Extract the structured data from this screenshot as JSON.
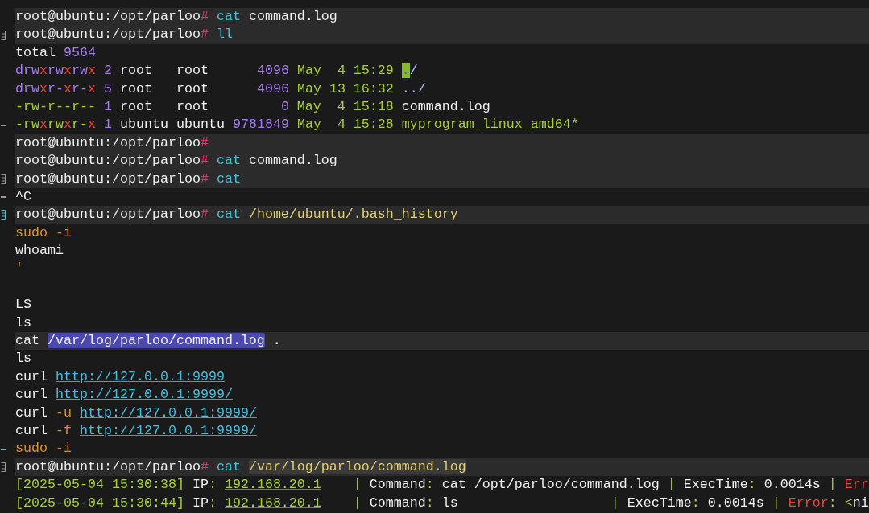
{
  "terminal": {
    "lines": [
      {
        "highlighted": true,
        "segments": [
          {
            "kind": "plain",
            "text": "root@ubuntu:/opt/parloo"
          },
          {
            "kind": "hash",
            "text": "# "
          },
          {
            "kind": "cmd",
            "text": "cat"
          },
          {
            "kind": "plain",
            "text": " command.log"
          }
        ]
      },
      {
        "highlighted": true,
        "gutter": {
          "kind": "box"
        },
        "segments": [
          {
            "kind": "plain",
            "text": "root@ubuntu:/opt/parloo"
          },
          {
            "kind": "hash",
            "text": "# "
          },
          {
            "kind": "cmd",
            "text": "ll"
          }
        ]
      },
      {
        "highlighted": false,
        "segments": [
          {
            "kind": "plain",
            "text": "total "
          },
          {
            "kind": "num",
            "text": "9564"
          }
        ]
      },
      {
        "highlighted": false,
        "segments": [
          {
            "kind": "num",
            "text": "drw"
          },
          {
            "kind": "err",
            "text": "x"
          },
          {
            "kind": "num",
            "text": "rw"
          },
          {
            "kind": "err",
            "text": "x"
          },
          {
            "kind": "num",
            "text": "rw"
          },
          {
            "kind": "err",
            "text": "x"
          },
          {
            "kind": "num",
            "text": " 2"
          },
          {
            "kind": "plain",
            "text": " root   root      "
          },
          {
            "kind": "num",
            "text": "4096"
          },
          {
            "kind": "green",
            "text": " May  4 15:29 "
          },
          {
            "kind": "cursor",
            "text": "."
          },
          {
            "kind": "dir",
            "text": "/"
          }
        ]
      },
      {
        "highlighted": false,
        "segments": [
          {
            "kind": "num",
            "text": "drw"
          },
          {
            "kind": "err",
            "text": "x"
          },
          {
            "kind": "num",
            "text": "r-"
          },
          {
            "kind": "err",
            "text": "x"
          },
          {
            "kind": "num",
            "text": "r-"
          },
          {
            "kind": "err",
            "text": "x"
          },
          {
            "kind": "num",
            "text": " 5"
          },
          {
            "kind": "plain",
            "text": " root   root      "
          },
          {
            "kind": "num",
            "text": "4096"
          },
          {
            "kind": "green",
            "text": " May 13 16:32"
          },
          {
            "kind": "dir",
            "text": " ../"
          }
        ]
      },
      {
        "highlighted": false,
        "segments": [
          {
            "kind": "green",
            "text": "-rw-r--r--"
          },
          {
            "kind": "num",
            "text": " 1"
          },
          {
            "kind": "plain",
            "text": " root   root         "
          },
          {
            "kind": "num",
            "text": "0"
          },
          {
            "kind": "green",
            "text": " May  4 15:18"
          },
          {
            "kind": "plain",
            "text": " command.log"
          }
        ]
      },
      {
        "highlighted": false,
        "gutter": {
          "kind": "dash"
        },
        "segments": [
          {
            "kind": "green",
            "text": "-rw"
          },
          {
            "kind": "err",
            "text": "x"
          },
          {
            "kind": "green",
            "text": "rw"
          },
          {
            "kind": "err",
            "text": "x"
          },
          {
            "kind": "green",
            "text": "r-"
          },
          {
            "kind": "err",
            "text": "x"
          },
          {
            "kind": "num",
            "text": " 1"
          },
          {
            "kind": "plain",
            "text": " ubuntu ubuntu "
          },
          {
            "kind": "num",
            "text": "9781849"
          },
          {
            "kind": "green",
            "text": " May  4 15:28 myprogram_linux_amd64*"
          }
        ]
      },
      {
        "highlighted": true,
        "segments": [
          {
            "kind": "plain",
            "text": "root@ubuntu:/opt/parloo"
          },
          {
            "kind": "hash",
            "text": "#"
          }
        ]
      },
      {
        "highlighted": true,
        "segments": [
          {
            "kind": "plain",
            "text": "root@ubuntu:/opt/parloo"
          },
          {
            "kind": "hash",
            "text": "# "
          },
          {
            "kind": "cmd",
            "text": "cat"
          },
          {
            "kind": "plain",
            "text": " command.log"
          }
        ]
      },
      {
        "highlighted": true,
        "gutter": {
          "kind": "box"
        },
        "segments": [
          {
            "kind": "plain",
            "text": "root@ubuntu:/opt/parloo"
          },
          {
            "kind": "hash",
            "text": "# "
          },
          {
            "kind": "cmd",
            "text": "cat"
          }
        ]
      },
      {
        "highlighted": false,
        "gutter": {
          "kind": "dash"
        },
        "segments": [
          {
            "kind": "plain",
            "text": "^C"
          }
        ]
      },
      {
        "highlighted": true,
        "gutter": {
          "kind": "box-active"
        },
        "segments": [
          {
            "kind": "plain",
            "text": "root@ubuntu:/opt/parloo"
          },
          {
            "kind": "hash",
            "text": "# "
          },
          {
            "kind": "cmd",
            "text": "cat "
          },
          {
            "kind": "arg",
            "text": "/home/ubuntu/.bash_history"
          }
        ]
      },
      {
        "highlighted": false,
        "segments": [
          {
            "kind": "flag",
            "text": "sudo -i"
          }
        ]
      },
      {
        "highlighted": false,
        "segments": [
          {
            "kind": "plain",
            "text": "whoami"
          }
        ]
      },
      {
        "highlighted": false,
        "segments": [
          {
            "kind": "flag",
            "text": "'"
          }
        ]
      },
      {
        "highlighted": false
      },
      {
        "highlighted": false,
        "segments": [
          {
            "kind": "plain",
            "text": "LS"
          }
        ]
      },
      {
        "highlighted": false,
        "segments": [
          {
            "kind": "plain",
            "text": "ls"
          }
        ]
      },
      {
        "highlighted": true,
        "segments": [
          {
            "kind": "plain",
            "text": "cat "
          },
          {
            "kind": "selected",
            "text": "/var/log/parloo/command.log"
          },
          {
            "kind": "plain",
            "text": " ."
          }
        ]
      },
      {
        "highlighted": false,
        "segments": [
          {
            "kind": "plain",
            "text": "ls"
          }
        ]
      },
      {
        "highlighted": false,
        "segments": [
          {
            "kind": "plain",
            "text": "curl "
          },
          {
            "kind": "link",
            "text": "http://127.0.0.1:9999"
          }
        ]
      },
      {
        "highlighted": false,
        "segments": [
          {
            "kind": "plain",
            "text": "curl "
          },
          {
            "kind": "link",
            "text": "http://127.0.0.1:9999/"
          }
        ]
      },
      {
        "highlighted": false,
        "segments": [
          {
            "kind": "plain",
            "text": "curl "
          },
          {
            "kind": "flag",
            "text": "-u "
          },
          {
            "kind": "link",
            "text": "http://127.0.0.1:9999/"
          }
        ]
      },
      {
        "highlighted": false,
        "segments": [
          {
            "kind": "plain",
            "text": "curl "
          },
          {
            "kind": "flag",
            "text": "-f "
          },
          {
            "kind": "link",
            "text": "http://127.0.0.1:9999/"
          }
        ]
      },
      {
        "highlighted": false,
        "gutter": {
          "kind": "dash-active"
        },
        "segments": [
          {
            "kind": "flag",
            "text": "sudo -i"
          }
        ]
      },
      {
        "highlighted": true,
        "gutter": {
          "kind": "box"
        },
        "segments": [
          {
            "kind": "plain",
            "text": "root@ubuntu:/opt/parloo"
          },
          {
            "kind": "hash",
            "text": "# "
          },
          {
            "kind": "cmd",
            "text": "cat "
          },
          {
            "kind": "boxed",
            "text": "/var/log/parloo/command.log"
          }
        ]
      },
      {
        "highlighted": false,
        "segments": [
          {
            "kind": "green",
            "text": "[2025-05-04 15:30:38]"
          },
          {
            "kind": "plain",
            "text": " IP"
          },
          {
            "kind": "green",
            "text": ": "
          },
          {
            "kind": "ip",
            "text": "192.168.20.1"
          },
          {
            "kind": "green",
            "text": "    | "
          },
          {
            "kind": "plain",
            "text": "Command"
          },
          {
            "kind": "green",
            "text": ": "
          },
          {
            "kind": "plain",
            "text": "cat /opt/parloo/command.log"
          },
          {
            "kind": "green",
            "text": " | "
          },
          {
            "kind": "plain",
            "text": "ExecTime"
          },
          {
            "kind": "green",
            "text": ": "
          },
          {
            "kind": "plain",
            "text": "0.0014s"
          },
          {
            "kind": "green",
            "text": " | "
          },
          {
            "kind": "err",
            "text": "Err"
          }
        ]
      },
      {
        "highlighted": false,
        "segments": [
          {
            "kind": "green",
            "text": "[2025-05-04 15:30:44]"
          },
          {
            "kind": "plain",
            "text": " IP"
          },
          {
            "kind": "green",
            "text": ": "
          },
          {
            "kind": "ip",
            "text": "192.168.20.1"
          },
          {
            "kind": "green",
            "text": "    | "
          },
          {
            "kind": "plain",
            "text": "Command"
          },
          {
            "kind": "green",
            "text": ": "
          },
          {
            "kind": "plain",
            "text": "ls                   "
          },
          {
            "kind": "green",
            "text": "| "
          },
          {
            "kind": "plain",
            "text": "ExecTime"
          },
          {
            "kind": "green",
            "text": ": "
          },
          {
            "kind": "plain",
            "text": "0.0014s"
          },
          {
            "kind": "green",
            "text": " | "
          },
          {
            "kind": "err",
            "text": "Error"
          },
          {
            "kind": "green",
            "text": ": <"
          },
          {
            "kind": "plain",
            "text": "ni"
          }
        ]
      }
    ]
  }
}
